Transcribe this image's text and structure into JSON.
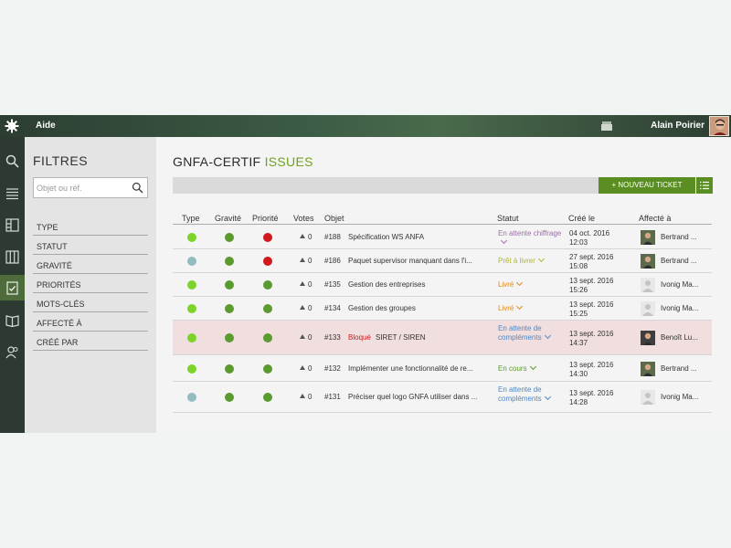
{
  "topbar": {
    "app_title": "Aide",
    "user_name": "Alain Poirier"
  },
  "filters": {
    "title": "FILTRES",
    "search_placeholder": "Objet ou réf.",
    "items": [
      "TYPE",
      "STATUT",
      "GRAVITÉ",
      "PRIORITÉS",
      "MOTS-CLÉS",
      "AFFECTÉ À",
      "CRÉÉ PAR"
    ]
  },
  "main": {
    "title_part1": "GNFA-CERTIF",
    "title_part2": "ISSUES",
    "new_ticket_label": "+ NOUVEAU TICKET",
    "columns": {
      "type": "Type",
      "gravity": "Gravité",
      "priority": "Priorité",
      "votes": "Votes",
      "object": "Objet",
      "status": "Statut",
      "created": "Créé le",
      "assigned": "Affecté à"
    }
  },
  "colors": {
    "accent": "#6ea21c",
    "button": "#5a8e22",
    "dot_green_light": "#7cd42a",
    "dot_green": "#5b9a2e",
    "dot_red": "#d0191c",
    "dot_teal": "#93bcc0",
    "status_purple": "#9b6fa8",
    "status_yellow": "#b2b534",
    "status_orange": "#e08a1e",
    "status_blue": "#4f88c4",
    "status_green": "#5b9a2e",
    "blocked": "#d0191c"
  },
  "tickets": [
    {
      "type_color": "#7cd42a",
      "gravity_color": "#5b9a2e",
      "priority_color": "#d0191c",
      "votes": "0",
      "ref": "#188",
      "blocked": "",
      "subject": "Spécification WS ANFA",
      "status": "En attente chiffrage",
      "status_color": "#9b6fa8",
      "date": "04 oct. 2016",
      "time": "12:03",
      "assignee": "Bertrand ...",
      "avatar": "photo"
    },
    {
      "type_color": "#93bcc0",
      "gravity_color": "#5b9a2e",
      "priority_color": "#d0191c",
      "votes": "0",
      "ref": "#186",
      "blocked": "",
      "subject": "Paquet supervisor manquant dans l'i...",
      "status": "Prêt à livrer",
      "status_color": "#b2b534",
      "date": "27 sept. 2016",
      "time": "15:08",
      "assignee": "Bertrand ...",
      "avatar": "photo"
    },
    {
      "type_color": "#7cd42a",
      "gravity_color": "#5b9a2e",
      "priority_color": "#5b9a2e",
      "votes": "0",
      "ref": "#135",
      "blocked": "",
      "subject": "Gestion des entreprises",
      "status": "Livré",
      "status_color": "#e08a1e",
      "date": "13 sept. 2016",
      "time": "15:26",
      "assignee": "Ivonig Ma...",
      "avatar": "blank"
    },
    {
      "type_color": "#7cd42a",
      "gravity_color": "#5b9a2e",
      "priority_color": "#5b9a2e",
      "votes": "0",
      "ref": "#134",
      "blocked": "",
      "subject": "Gestion des groupes",
      "status": "Livré",
      "status_color": "#e08a1e",
      "date": "13 sept. 2016",
      "time": "15:25",
      "assignee": "Ivonig Ma...",
      "avatar": "blank"
    },
    {
      "type_color": "#7cd42a",
      "gravity_color": "#5b9a2e",
      "priority_color": "#5b9a2e",
      "votes": "0",
      "ref": "#133",
      "blocked": "Bloqué",
      "subject": "SIRET / SIREN",
      "status": "En attente de compléments",
      "status_color": "#4f88c4",
      "date": "13 sept. 2016",
      "time": "14:37",
      "assignee": "Benoît Lu...",
      "avatar": "photo2"
    },
    {
      "type_color": "#7cd42a",
      "gravity_color": "#5b9a2e",
      "priority_color": "#5b9a2e",
      "votes": "0",
      "ref": "#132",
      "blocked": "",
      "subject": "Implémenter une fonctionnalité de re...",
      "status": "En cours",
      "status_color": "#5b9a2e",
      "date": "13 sept. 2016",
      "time": "14:30",
      "assignee": "Bertrand ...",
      "avatar": "photo"
    },
    {
      "type_color": "#93bcc0",
      "gravity_color": "#5b9a2e",
      "priority_color": "#5b9a2e",
      "votes": "0",
      "ref": "#131",
      "blocked": "",
      "subject": "Préciser quel logo GNFA utiliser dans ...",
      "status": "En attente de compléments",
      "status_color": "#4f88c4",
      "date": "13 sept. 2016",
      "time": "14:28",
      "assignee": "Ivonig Ma...",
      "avatar": "blank"
    }
  ]
}
